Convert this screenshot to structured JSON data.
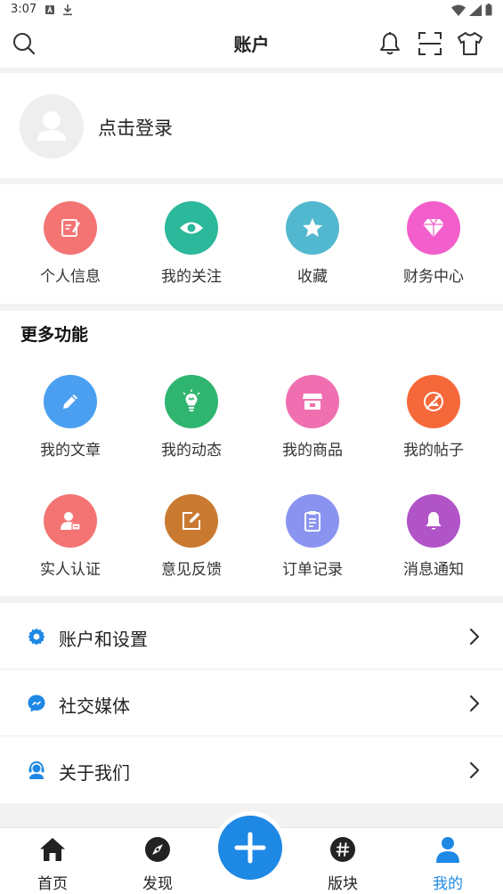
{
  "status_bar": {
    "time": "3:07"
  },
  "header": {
    "title": "账户",
    "icons": [
      "search-icon",
      "bell-icon",
      "scan-icon",
      "tshirt-icon"
    ]
  },
  "profile": {
    "login_text": "点击登录"
  },
  "quick_actions": [
    {
      "label": "个人信息",
      "icon": "edit-note-icon",
      "color": "#f47474"
    },
    {
      "label": "我的关注",
      "icon": "eye-icon",
      "color": "#2cb89a"
    },
    {
      "label": "收藏",
      "icon": "star-icon",
      "color": "#52b8cf"
    },
    {
      "label": "财务中心",
      "icon": "diamond-icon",
      "color": "#f25ecb"
    }
  ],
  "more_features": {
    "title": "更多功能",
    "items": [
      {
        "label": "我的文章",
        "icon": "pencil-icon",
        "color": "#4a9ff0"
      },
      {
        "label": "我的动态",
        "icon": "lightbulb-icon",
        "color": "#2fb570"
      },
      {
        "label": "我的商品",
        "icon": "store-icon",
        "color": "#f06fb0"
      },
      {
        "label": "我的帖子",
        "icon": "no-image-icon",
        "color": "#f5683a"
      },
      {
        "label": "实人认证",
        "icon": "id-badge-icon",
        "color": "#f47474"
      },
      {
        "label": "意见反馈",
        "icon": "feedback-icon",
        "color": "#c97a30"
      },
      {
        "label": "订单记录",
        "icon": "clipboard-icon",
        "color": "#8a94f0"
      },
      {
        "label": "消息通知",
        "icon": "bell-icon",
        "color": "#b054c8"
      }
    ]
  },
  "list": [
    {
      "label": "账户和设置",
      "icon": "gear-icon"
    },
    {
      "label": "社交媒体",
      "icon": "messenger-icon"
    },
    {
      "label": "关于我们",
      "icon": "support-agent-icon"
    }
  ],
  "bottom_nav": {
    "items": [
      {
        "label": "首页",
        "icon": "home-icon"
      },
      {
        "label": "发现",
        "icon": "compass-icon"
      },
      {
        "label": "版块",
        "icon": "hashtag-icon"
      },
      {
        "label": "我的",
        "icon": "person-icon"
      }
    ],
    "active": "我的",
    "fab_icon": "plus-icon"
  },
  "colors": {
    "accent": "#1e88e5",
    "background": "#f2f2f2"
  }
}
